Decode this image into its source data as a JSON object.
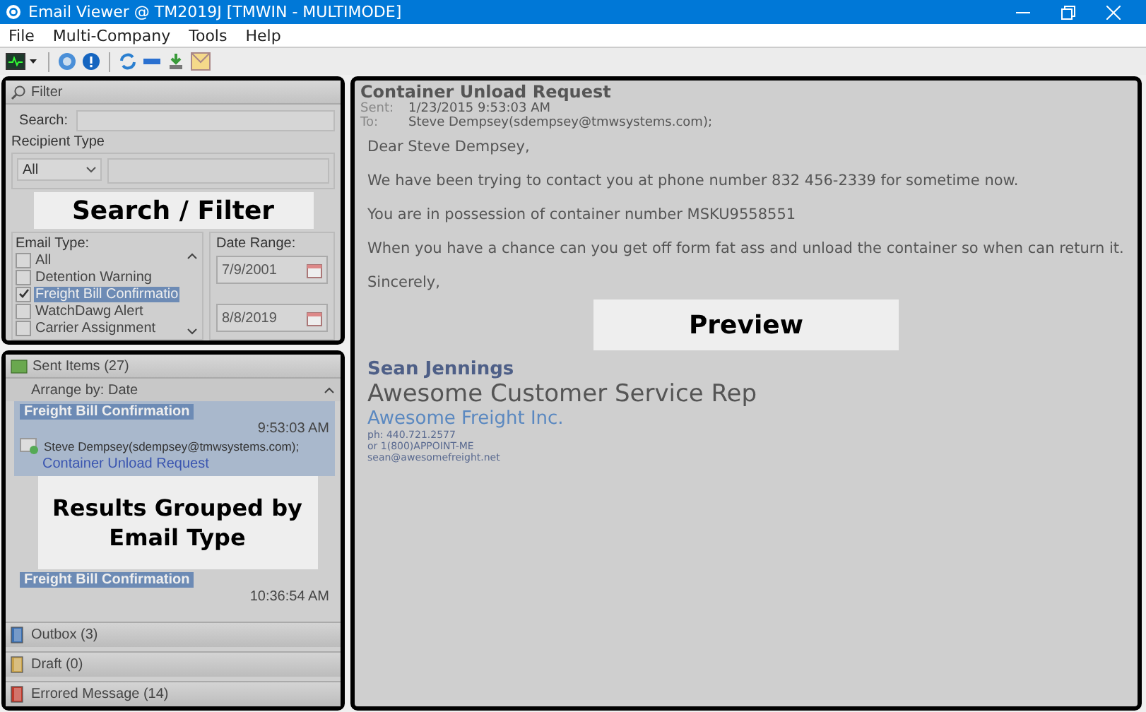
{
  "window": {
    "title": "Email Viewer @ TM2019J [TMWIN - MULTIMODE]"
  },
  "menu": [
    "File",
    "Multi-Company",
    "Tools",
    "Help"
  ],
  "filter": {
    "title": "Filter",
    "search_label": "Search:",
    "recipient_type_label": "Recipient Type",
    "recipient_type": "All",
    "email_type_label": "Email Type:",
    "date_range_label": "Date Range:",
    "date_from": "7/9/2001",
    "date_to": "8/8/2019",
    "callout": "Search / Filter",
    "email_types": [
      {
        "label": "All",
        "checked": false,
        "selected": false
      },
      {
        "label": "Detention Warning",
        "checked": false,
        "selected": false
      },
      {
        "label": "Freight Bill Confirmatio",
        "checked": true,
        "selected": true
      },
      {
        "label": "WatchDawg Alert",
        "checked": false,
        "selected": false
      },
      {
        "label": "Carrier Assignment",
        "checked": false,
        "selected": false
      }
    ]
  },
  "results": {
    "folder": "Sent Items (27)",
    "arrange": "Arrange by: Date",
    "callout": "Results Grouped by Email Type",
    "items": [
      {
        "group": "Freight Bill Confirmation",
        "time": "9:53:03 AM",
        "recipient": "Steve Dempsey(sdempsey@tmwsystems.com);",
        "subject": "Container Unload Request",
        "selected": true
      },
      {
        "group": "Freight Bill Confirmation",
        "time": "10:36:54 AM",
        "selected": false
      }
    ],
    "folders": [
      {
        "label": "Outbox (3)",
        "kind": "outbox"
      },
      {
        "label": "Draft (0)",
        "kind": "draft"
      },
      {
        "label": "Errored Message (14)",
        "kind": "error"
      }
    ]
  },
  "preview": {
    "subject": "Container Unload Request",
    "sent_label": "Sent:",
    "sent": "1/23/2015 9:53:03 AM",
    "to_label": "To:",
    "to": "Steve Dempsey(sdempsey@tmwsystems.com);",
    "callout": "Preview",
    "body": [
      "Dear Steve Dempsey,",
      "We have been trying to contact you at phone number 832 456-2339 for sometime now.",
      "You are in possession of container number  MSKU9558551",
      "When you have a chance can you get off form fat ass and unload the container so when can return it.",
      "Sincerely,"
    ],
    "signature": {
      "name": "Sean Jennings",
      "title": "Awesome Customer Service Rep",
      "company": "Awesome Freight Inc.",
      "lines": [
        "ph: 440.721.2577",
        "or 1(800)APPOINT-ME",
        "sean@awesomefreight.net"
      ]
    }
  }
}
